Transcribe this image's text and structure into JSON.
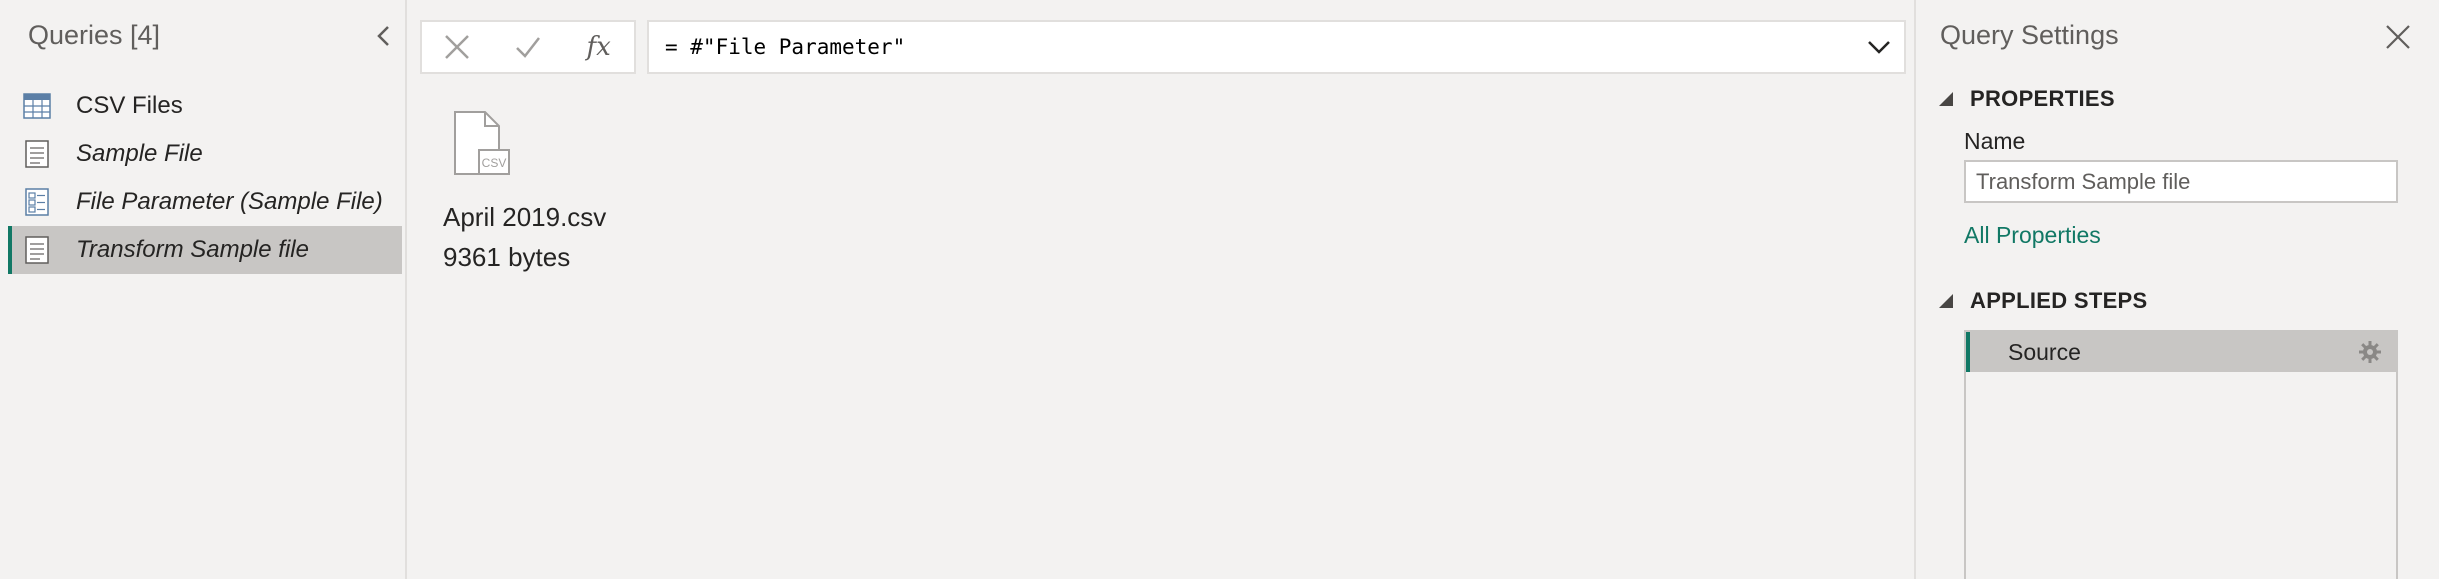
{
  "queries": {
    "header": "Queries [4]",
    "items": [
      {
        "label": "CSV Files",
        "icon": "table-icon",
        "italic": false
      },
      {
        "label": "Sample File",
        "icon": "document-icon",
        "italic": true
      },
      {
        "label": "File Parameter (Sample File)",
        "icon": "parameter-icon",
        "italic": true
      },
      {
        "label": "Transform Sample file",
        "icon": "document-icon",
        "italic": true,
        "selected": true
      }
    ]
  },
  "formula": {
    "text": "= #\"File Parameter\"",
    "fx_label": "fx"
  },
  "preview": {
    "file_name": "April 2019.csv",
    "file_size": "9361 bytes",
    "file_badge": "CSV"
  },
  "settings": {
    "title": "Query Settings",
    "properties_label": "PROPERTIES",
    "name_label": "Name",
    "name_value": "Transform Sample file",
    "all_properties_label": "All Properties",
    "applied_steps_label": "APPLIED STEPS",
    "steps": [
      {
        "label": "Source",
        "selected": true
      }
    ]
  },
  "colors": {
    "accent": "#117865",
    "selection": "#c8c6c4",
    "background": "#f3f2f1"
  }
}
